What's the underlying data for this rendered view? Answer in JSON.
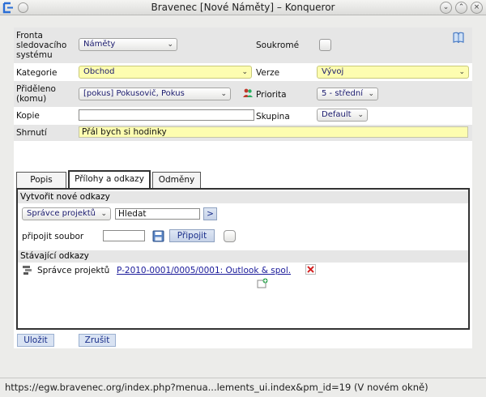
{
  "window": {
    "title": "Bravenec [Nové Náměty] – Konqueror"
  },
  "form": {
    "queue_label": "Fronta sledovacího systému",
    "queue_value": "Náměty",
    "private_label": "Soukromé",
    "category_label": "Kategorie",
    "category_value": "Obchod",
    "version_label": "Verze",
    "version_value": "Vývoj",
    "assigned_label": "Přiděleno (komu)",
    "assigned_value": "[pokus] Pokusovič, Pokus",
    "priority_label": "Priorita",
    "priority_value": "5 - střední",
    "copy_label": "Kopie",
    "copy_value": "",
    "group_label": "Skupina",
    "group_value": "Default",
    "summary_label": "Shrnutí",
    "summary_value": "Přál bych si hodinky"
  },
  "tabs": [
    {
      "label": "Popis"
    },
    {
      "label": "Přílohy a odkazy"
    },
    {
      "label": "Odměny"
    }
  ],
  "links_panel": {
    "create_header": "Vytvořit nové odkazy",
    "app_select": "Správce projektů",
    "search_value": "Hledat",
    "go_label": ">",
    "attach_label": "připojit soubor",
    "attach_button": "Připojit",
    "existing_header": "Stávající odkazy",
    "existing_app": "Správce projektů",
    "existing_link": "P-2010-0001/0005/0001: Outlook & spol."
  },
  "actions": {
    "save": "Uložit",
    "cancel": "Zrušit"
  },
  "status": {
    "text": "https://egw.bravenec.org/index.php?menua...lements_ui.index&pm_id=19 (V novém okně)"
  },
  "colors": {
    "highlight_yellow": "#fdfdb0",
    "button_blue": "#d9e3f3",
    "link_blue": "#1a1a9a"
  },
  "icons": [
    "konqueror-icon",
    "book-icon",
    "user-group-icon",
    "save-disk-icon",
    "project-icon",
    "delete-icon",
    "add-comment-icon"
  ]
}
